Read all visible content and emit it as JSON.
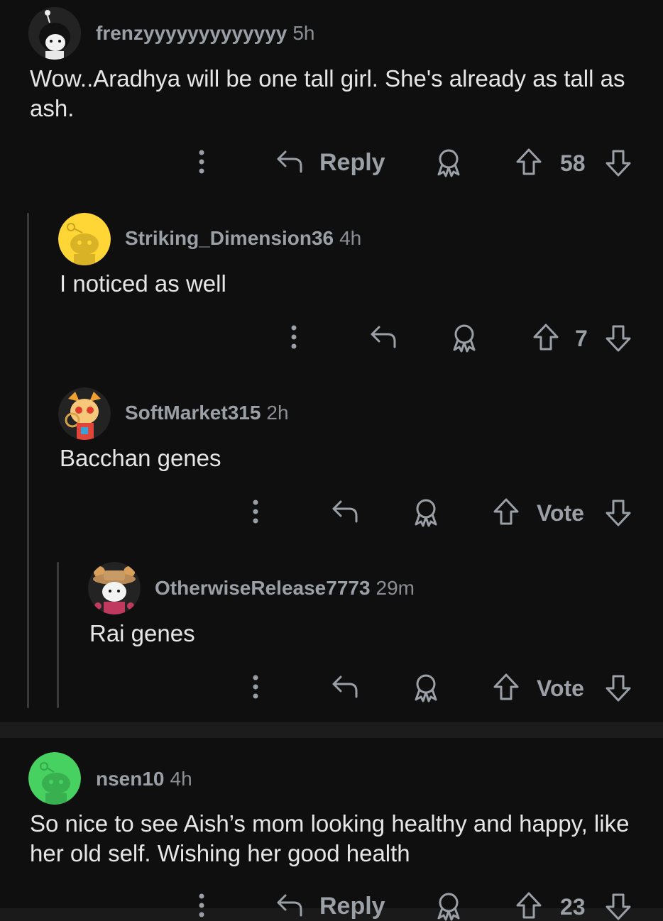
{
  "comments": [
    {
      "username": "frenzyyyyyyyyyyyyy",
      "age": "5h",
      "text": "Wow..Aradhya will be one tall girl. She's already as tall as ash.",
      "action_label": "Reply",
      "vote_label": "58"
    },
    {
      "username": "Striking_Dimension36",
      "age": "4h",
      "text": "I noticed as well",
      "vote_label": "7"
    },
    {
      "username": "SoftMarket315",
      "age": "2h",
      "text": "Bacchan genes",
      "vote_label": "Vote"
    },
    {
      "username": "OtherwiseRelease7773",
      "age": "29m",
      "text": "Rai genes",
      "vote_label": "Vote"
    },
    {
      "username": "nsen10",
      "age": "4h",
      "text": "So nice to see Aish’s mom looking healthy and happy, like her old self. Wishing her good health",
      "action_label": "Reply",
      "vote_label": "23"
    }
  ],
  "colors": {
    "background": "#0f0f0f",
    "text": "#e6e6e6",
    "muted": "#9aa0a6",
    "avatar_yellow": "#ffd635",
    "avatar_green": "#46d160"
  },
  "icons": [
    "more-vertical-icon",
    "reply-arrow-icon",
    "award-icon",
    "upvote-icon",
    "downvote-icon"
  ]
}
